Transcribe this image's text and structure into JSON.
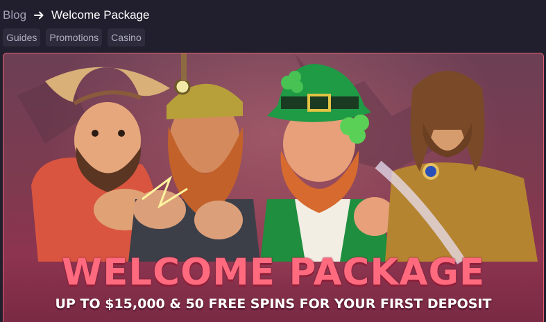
{
  "breadcrumb": {
    "parent": "Blog",
    "current": "Welcome Package"
  },
  "tags": [
    "Guides",
    "Promotions",
    "Casino"
  ],
  "banner": {
    "title": "WELCOME PACKAGE",
    "subtitle": "UP TO $15,000 & 50 FREE SPINS FOR YOUR FIRST DEPOSIT",
    "characters": [
      "cowboy",
      "miner",
      "leprechaun",
      "warrior"
    ]
  },
  "colors": {
    "page_bg": "#211f2d",
    "tag_bg": "#2e2c3c",
    "banner_border": "#e4606f",
    "title": "#ff6a7e"
  }
}
